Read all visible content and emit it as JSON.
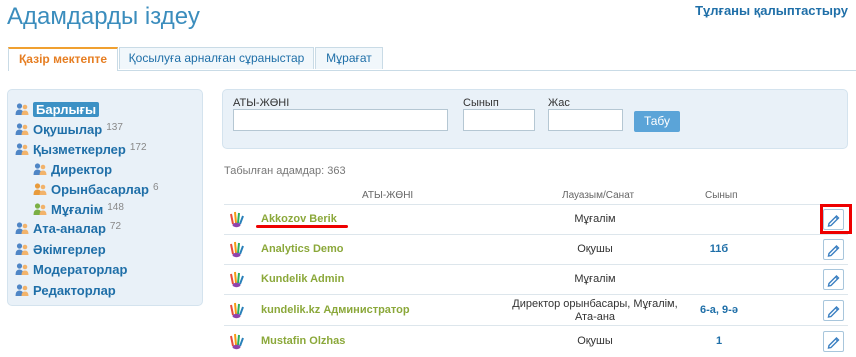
{
  "page": {
    "title": "Адамдарды іздеу",
    "restore_link": "Тұлғаны қалыптастыру"
  },
  "tabs": [
    {
      "label": "Қазір мектепте",
      "active": true
    },
    {
      "label": "Қосылуға арналған сұраныстар",
      "active": false
    },
    {
      "label": "Мұрағат",
      "active": false
    }
  ],
  "sidebar": {
    "items": [
      {
        "label": "Барлығы",
        "count": "",
        "selected": true
      },
      {
        "label": "Оқушылар",
        "count": "137"
      },
      {
        "label": "Қызметкерлер",
        "count": "172"
      },
      {
        "label": "Директор",
        "count": ""
      },
      {
        "label": "Орынбасарлар",
        "count": "6"
      },
      {
        "label": "Мұғалім",
        "count": "148"
      },
      {
        "label": "Ата-аналар",
        "count": "72"
      },
      {
        "label": "Әкімгерлер",
        "count": ""
      },
      {
        "label": "Модераторлар",
        "count": ""
      },
      {
        "label": "Редакторлар",
        "count": ""
      }
    ]
  },
  "search": {
    "name_label": "АТЫ-ЖӨНІ",
    "class_label": "Сынып",
    "age_label": "Жас",
    "name_value": "",
    "class_value": "",
    "age_value": "",
    "button_label": "Табу"
  },
  "results": {
    "found_text": "Табылған адамдар: 363",
    "headers": {
      "name": "АТЫ-ЖӨНІ",
      "role": "Лауазым/Санат",
      "class": "Сынып"
    },
    "rows": [
      {
        "name": "Akkozov Berik",
        "role": "Мұғалім",
        "class": ""
      },
      {
        "name": "Analytics Demo",
        "role": "Оқушы",
        "class": "11б"
      },
      {
        "name": "Kundelik Admin",
        "role": "Мұғалім",
        "class": ""
      },
      {
        "name": "kundelik.kz Администратор",
        "role": "Директор орынбасары, Мұғалім, Ата-ана",
        "class": "6-а, 9-ә"
      },
      {
        "name": "Mustafin Olzhas",
        "role": "Оқушы",
        "class": "1"
      }
    ]
  },
  "colors": {
    "accent": "#3b8dbd",
    "link": "#1f6fa8",
    "name_green": "#8ba83a",
    "tab_active": "#e67e22",
    "highlight": "#ee0000"
  },
  "icons": {
    "sidebar": "people-icon",
    "row": "user-hand-icon",
    "edit": "pencil-icon"
  }
}
